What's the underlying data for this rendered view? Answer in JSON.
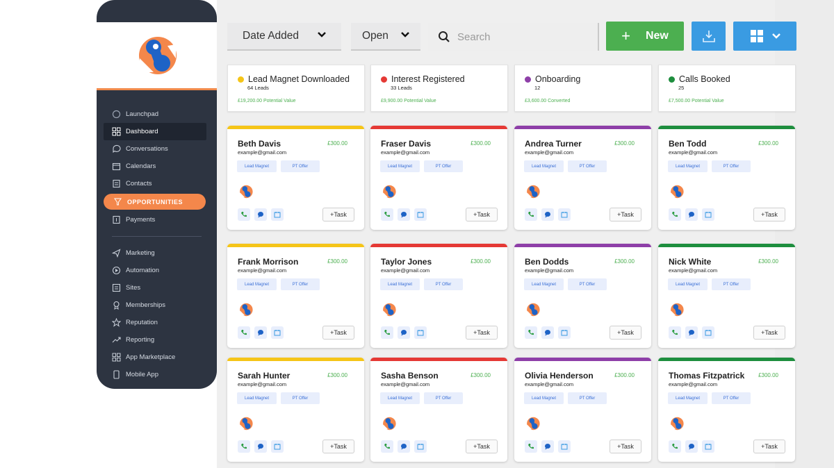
{
  "colors": {
    "sidebar_bg": "#2d3441",
    "accent_orange": "#f4874b",
    "accent_blue": "#3a9be2",
    "accent_green": "#4caf50",
    "stage_yellow": "#f5c518",
    "stage_red": "#e53935",
    "stage_purple": "#8e3fa8",
    "stage_green": "#1e8e3e"
  },
  "sidebar": {
    "items": [
      {
        "label": "Launchpad",
        "icon": "rocket-icon"
      },
      {
        "label": "Dashboard",
        "icon": "grid-icon"
      },
      {
        "label": "Conversations",
        "icon": "chat-icon"
      },
      {
        "label": "Calendars",
        "icon": "calendar-icon"
      },
      {
        "label": "Contacts",
        "icon": "contacts-icon"
      },
      {
        "label": "OPPORTUNITIES",
        "icon": "funnel-icon"
      },
      {
        "label": "Payments",
        "icon": "payments-icon"
      },
      {
        "label": "Marketing",
        "icon": "send-icon"
      },
      {
        "label": "Automation",
        "icon": "automation-icon"
      },
      {
        "label": "Sites",
        "icon": "sites-icon"
      },
      {
        "label": "Memberships",
        "icon": "badge-icon"
      },
      {
        "label": "Reputation",
        "icon": "star-icon"
      },
      {
        "label": "Reporting",
        "icon": "trend-icon"
      },
      {
        "label": "App Marketplace",
        "icon": "apps-icon"
      },
      {
        "label": "Mobile App",
        "icon": "phone-icon"
      }
    ]
  },
  "toolbar": {
    "sort_label": "Date Added",
    "status_label": "Open",
    "search_placeholder": "Search",
    "new_label": "New"
  },
  "stages": [
    {
      "title": "Lead Magnet Downloaded",
      "count": "64 Leads",
      "value": "£19,200.00 Potential Value",
      "color": "#f5c518"
    },
    {
      "title": "Interest Registered",
      "count": "33 Leads",
      "value": "£9,900.00 Potential Value",
      "color": "#e53935"
    },
    {
      "title": "Onboarding",
      "count": "12",
      "value": "£3,600.00 Converted",
      "color": "#8e3fa8"
    },
    {
      "title": "Calls Booked",
      "count": "25",
      "value": "£7,500.00 Potential Value",
      "color": "#1e8e3e"
    }
  ],
  "card_common": {
    "email": "example@gmail.com",
    "price": "£300.00",
    "tag1": "Lead Magnet",
    "tag2": "PT Offer",
    "task_label": "+Task"
  },
  "cards": [
    [
      "Beth Davis",
      "Fraser Davis",
      "Andrea Turner",
      "Ben Todd"
    ],
    [
      "Frank Morrison",
      "Taylor Jones",
      "Ben Dodds",
      "Nick White"
    ],
    [
      "Sarah Hunter",
      "Sasha Benson",
      "Olivia Henderson",
      "Thomas Fitzpatrick"
    ]
  ]
}
